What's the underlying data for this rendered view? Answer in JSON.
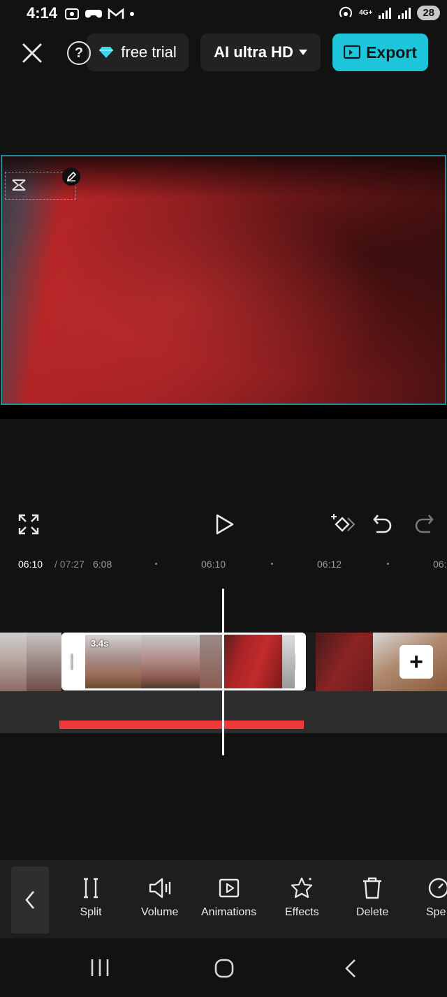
{
  "status_bar": {
    "time": "4:14",
    "network": "4G+",
    "battery": "28"
  },
  "top_bar": {
    "trial_label": "free trial",
    "quality_label": "AI ultra HD",
    "export_label": "Export"
  },
  "timeline": {
    "current_time": "06:10",
    "total_time": "/ 07:27",
    "ticks": [
      "6:08",
      "06:10",
      "06:12",
      "06:"
    ],
    "clip_duration": "3.4s"
  },
  "toolbar": {
    "items": [
      {
        "label": "Split",
        "icon": "split-icon"
      },
      {
        "label": "Volume",
        "icon": "volume-icon"
      },
      {
        "label": "Animations",
        "icon": "animations-icon"
      },
      {
        "label": "Effects",
        "icon": "effects-icon"
      },
      {
        "label": "Delete",
        "icon": "delete-icon"
      },
      {
        "label": "Spe",
        "icon": "speed-icon"
      }
    ]
  },
  "colors": {
    "accent": "#1dc6da",
    "selection_border": "#1a8b98",
    "audio_bar": "#f03a3a"
  }
}
